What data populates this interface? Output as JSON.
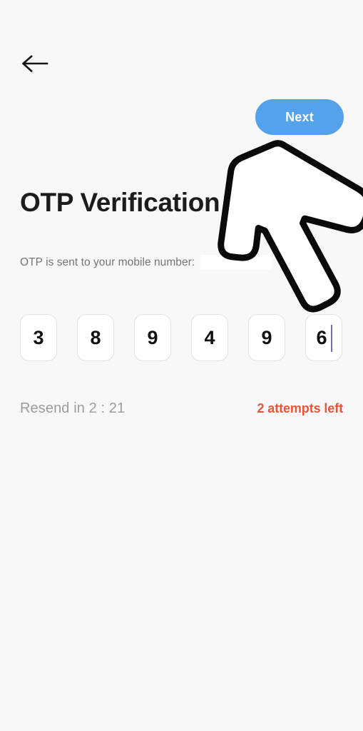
{
  "screen": {
    "background_color": "#f8f8f8",
    "title": "OTP Verification"
  },
  "header": {
    "back_icon": "arrow-left-icon",
    "next_label": "Next",
    "next_color": "#55a2ec",
    "next_text_color": "#ffffff"
  },
  "subtitle": {
    "text": "OTP is sent to your mobile number:",
    "phone_number_masked": "",
    "color": "#757575"
  },
  "otp": {
    "digits": [
      "3",
      "8",
      "9",
      "4",
      "9",
      "6"
    ],
    "active_index": 5,
    "caret_color": "#7b6bb5",
    "cell_border_color": "#e2e2e2",
    "cell_background": "#ffffff",
    "digit_color": "#111111"
  },
  "footer": {
    "resend_label": "Resend in 2 : 21",
    "resend_color": "#9c9c9c",
    "attempts_label": "2 attempts left",
    "attempts_color": "#e4573c"
  },
  "annotation": {
    "pointer_icon": "up-right-arrow-outline-icon",
    "pointer_stroke_color": "#000000",
    "pointer_fill_color": "#ffffff",
    "points_to": "Next"
  }
}
